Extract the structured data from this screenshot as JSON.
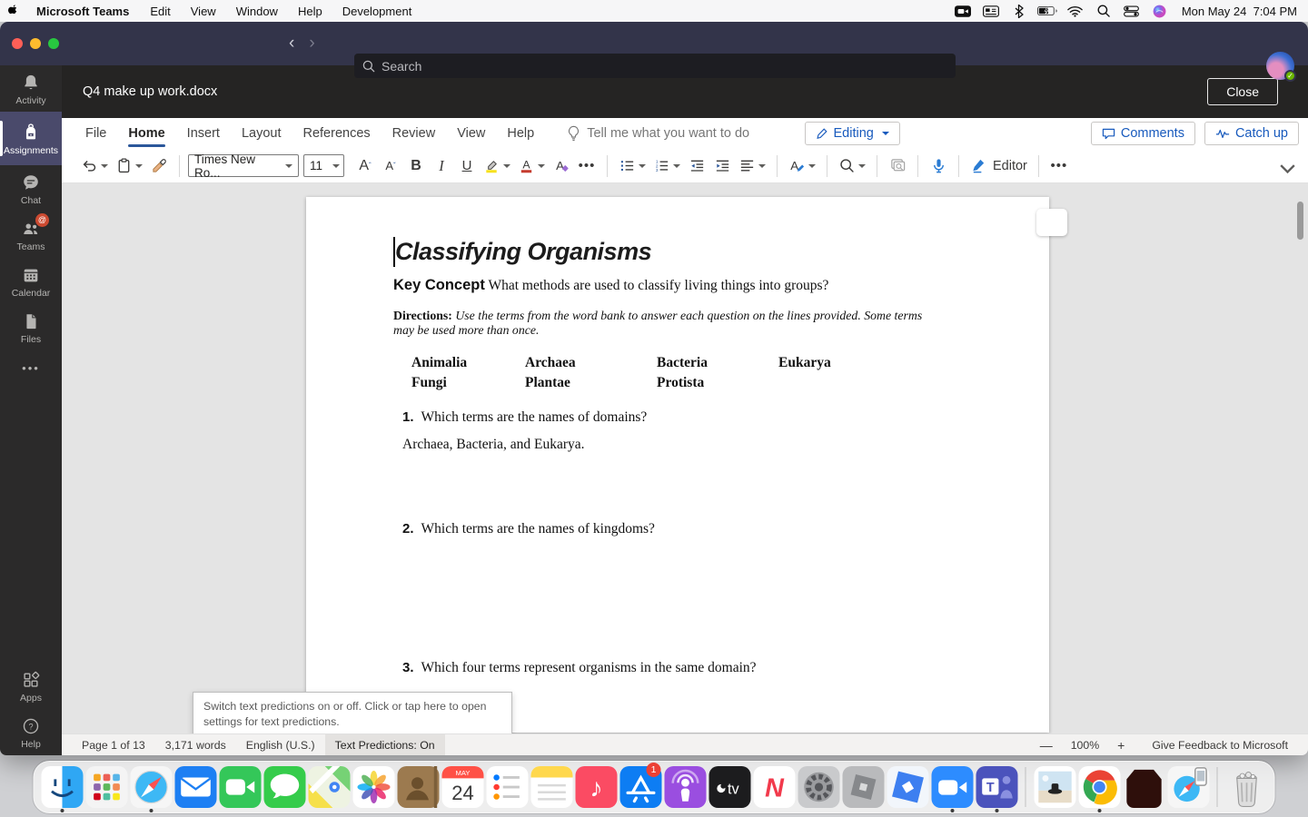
{
  "menubar": {
    "app_name": "Microsoft Teams",
    "menus": [
      "Edit",
      "View",
      "Window",
      "Help",
      "Development"
    ],
    "clock": "Mon May 24  7:04 PM",
    "status_icons": [
      "video-status-icon",
      "keyboard-input-icon",
      "bluetooth-icon",
      "battery-charging-icon",
      "wifi-icon",
      "spotlight-search-icon",
      "control-center-icon",
      "siri-icon"
    ]
  },
  "titlebar": {
    "search_placeholder": "Search"
  },
  "sidebar": {
    "items": [
      {
        "label": "Activity",
        "icon": "bell-icon",
        "selected": false
      },
      {
        "label": "Assignments",
        "icon": "backpack-icon",
        "selected": true
      },
      {
        "label": "Chat",
        "icon": "chat-bubble-icon",
        "selected": false
      },
      {
        "label": "Teams",
        "icon": "people-icon",
        "selected": false,
        "badge": "@"
      },
      {
        "label": "Calendar",
        "icon": "calendar-icon",
        "selected": false
      },
      {
        "label": "Files",
        "icon": "file-icon",
        "selected": false
      }
    ],
    "more_label": "•••",
    "bottom_items": [
      {
        "label": "Apps",
        "icon": "apps-grid-icon"
      },
      {
        "label": "Help",
        "icon": "help-circle-icon"
      }
    ]
  },
  "doc_header": {
    "title": "Q4 make up work.docx",
    "close_label": "Close"
  },
  "ribbon": {
    "tabs": [
      "File",
      "Home",
      "Insert",
      "Layout",
      "References",
      "Review",
      "View",
      "Help"
    ],
    "active_tab": "Home",
    "tell_me": "Tell me what you want to do",
    "editing_label": "Editing",
    "comments_label": "Comments",
    "catchup_label": "Catch up"
  },
  "toolbar": {
    "font_name": "Times New Ro...",
    "font_size": "11",
    "editor_label": "Editor",
    "more_label": "•••"
  },
  "doc": {
    "title": "Classifying Organisms",
    "key_concept_label": "Key Concept",
    "key_concept_text": " What methods are used to classify living things into groups?",
    "directions_label": "Directions:",
    "directions_text": " Use the terms from the word bank to answer each question on the lines provided. Some terms may be used more than once.",
    "word_bank_row1": [
      "Animalia",
      "Archaea",
      "Bacteria",
      "Eukarya"
    ],
    "word_bank_row2": [
      "Fungi",
      "Plantae",
      "Protista"
    ],
    "questions": [
      {
        "num": "1.",
        "text": "Which terms are the names of domains?",
        "answer": "Archaea, Bacteria, and Eukarya."
      },
      {
        "num": "2.",
        "text": "Which terms are the names of kingdoms?",
        "answer": ""
      },
      {
        "num": "3.",
        "text": "Which four terms represent organisms in the same domain?",
        "answer": ""
      }
    ]
  },
  "tooltip": {
    "text": "Switch text predictions on or off. Click or tap here to open settings for text predictions."
  },
  "statusbar": {
    "page": "Page 1 of 13",
    "words": "3,171 words",
    "language": "English (U.S.)",
    "predictions": "Text Predictions: On",
    "zoom_minus": "—",
    "zoom_value": "100%",
    "zoom_plus": "+",
    "feedback": "Give Feedback to Microsoft"
  },
  "colors": {
    "teams_titlebar": "#33344a",
    "teams_accent": "#4a4a6b",
    "word_blue": "#185abd",
    "tab_underline": "#2b579a",
    "badge_orange": "#cc4a31",
    "status_green": "#6bb700"
  },
  "dock": {
    "items": [
      {
        "name": "finder",
        "running": true
      },
      {
        "name": "launchpad",
        "running": false
      },
      {
        "name": "safari",
        "running": true
      },
      {
        "name": "mail",
        "running": false
      },
      {
        "name": "facetime",
        "running": false
      },
      {
        "name": "messages",
        "running": false
      },
      {
        "name": "maps",
        "running": false
      },
      {
        "name": "photos",
        "running": false
      },
      {
        "name": "contacts",
        "running": false
      },
      {
        "name": "calendar",
        "running": false,
        "month": "MAY",
        "day": "24"
      },
      {
        "name": "reminders",
        "running": false
      },
      {
        "name": "notes",
        "running": false
      },
      {
        "name": "music",
        "running": false
      },
      {
        "name": "app-store",
        "running": false,
        "badge": "1"
      },
      {
        "name": "podcasts",
        "running": false
      },
      {
        "name": "apple-tv",
        "running": false
      },
      {
        "name": "news",
        "running": false
      },
      {
        "name": "system-preferences",
        "running": false
      },
      {
        "name": "roblox",
        "running": false
      },
      {
        "name": "roblox-studio",
        "running": false
      },
      {
        "name": "zoom",
        "running": true
      },
      {
        "name": "teams",
        "running": true
      },
      {
        "name": "divider"
      },
      {
        "name": "photo-file",
        "running": false
      },
      {
        "name": "chrome",
        "running": true
      },
      {
        "name": "flash",
        "running": false
      },
      {
        "name": "simulator",
        "running": false
      },
      {
        "name": "divider"
      },
      {
        "name": "trash",
        "running": false
      }
    ]
  }
}
